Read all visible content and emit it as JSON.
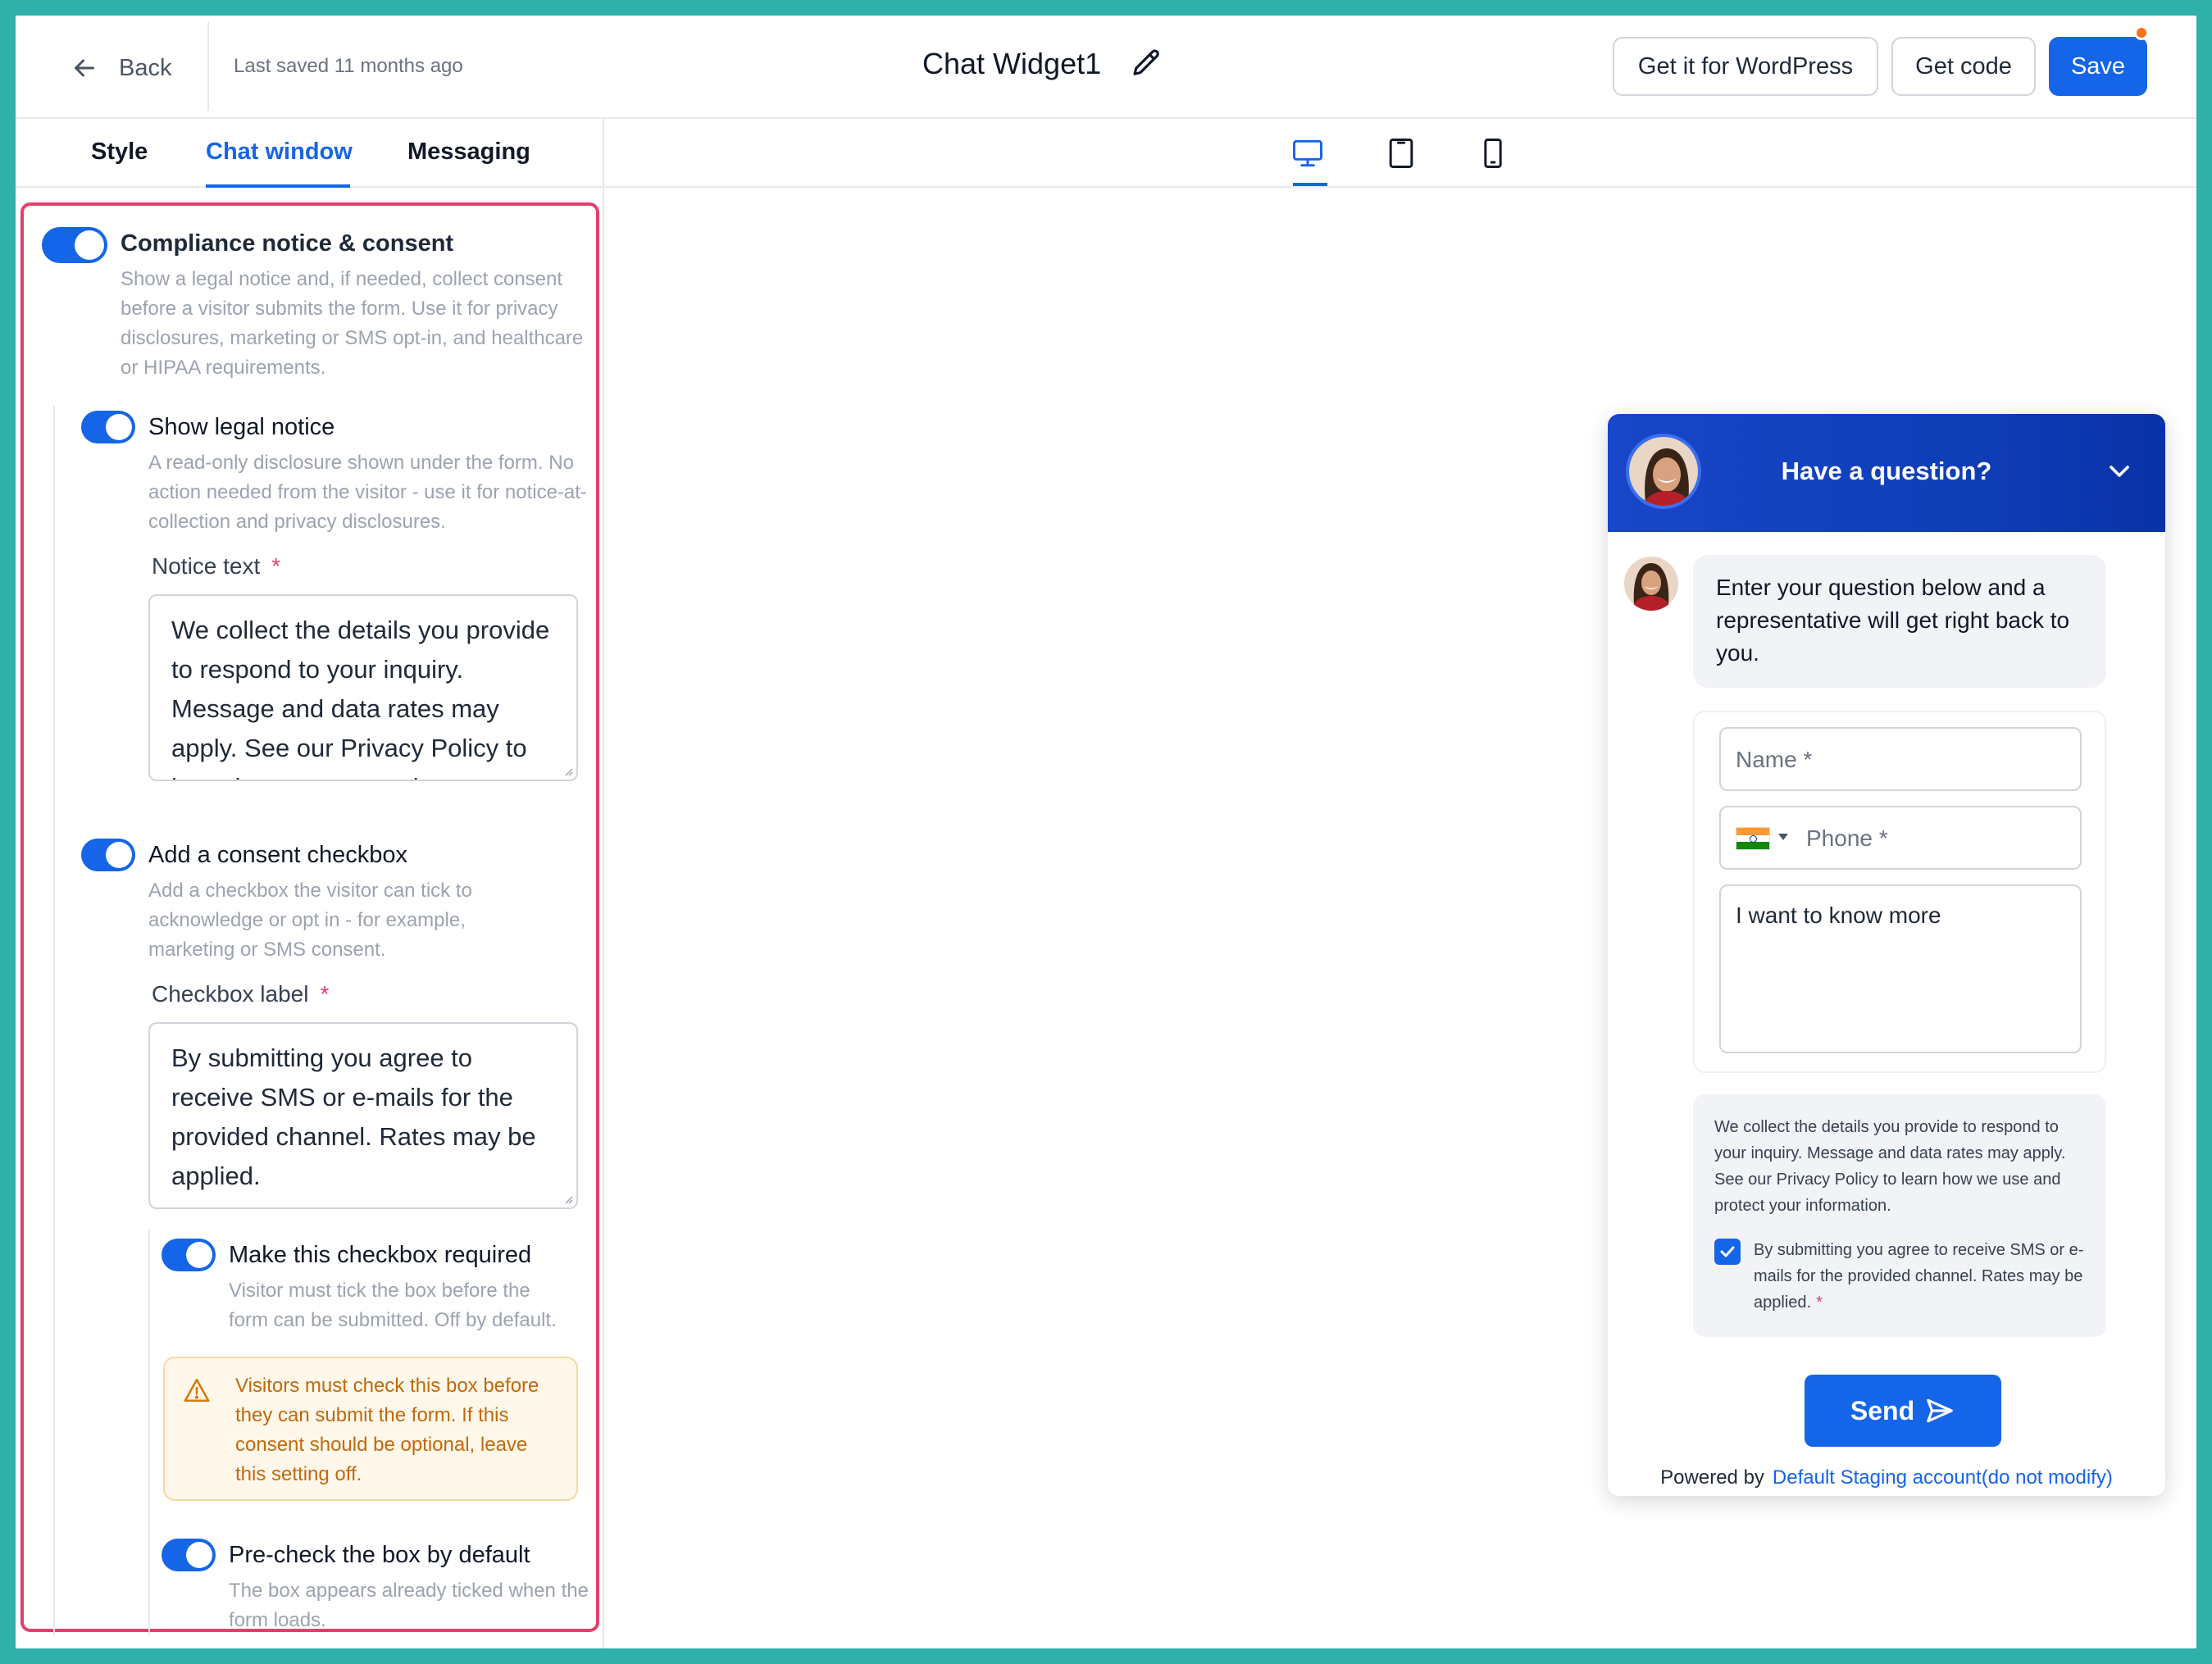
{
  "header": {
    "back_label": "Back",
    "last_saved": "Last saved 11 months ago",
    "title": "Chat Widget1",
    "wordpress_button": "Get it for WordPress",
    "code_button": "Get code",
    "save_button": "Save"
  },
  "tabs": [
    {
      "label": "Style",
      "active": false
    },
    {
      "label": "Chat window",
      "active": true
    },
    {
      "label": "Messaging",
      "active": false
    }
  ],
  "settings": {
    "compliance": {
      "label": "Compliance notice & consent",
      "enabled": true,
      "description": "Show a legal notice and, if needed, collect consent before a visitor submits the form. Use it for privacy disclosures, marketing or SMS opt-in, and healthcare or HIPAA requirements."
    },
    "legal_notice": {
      "label": "Show legal notice",
      "enabled": true,
      "description": "A read-only disclosure shown under the form. No action needed from the visitor - use it for notice-at-collection and privacy disclosures.",
      "field_label": "Notice text",
      "required_mark": "*",
      "value": "We collect the details you provide to respond to your inquiry. Message and data rates may apply. See our Privacy Policy to learn how we use and protect your information."
    },
    "consent_checkbox": {
      "label": "Add a consent checkbox",
      "enabled": true,
      "description": "Add a checkbox the visitor can tick to acknowledge or opt in - for example, marketing or SMS consent.",
      "field_label": "Checkbox label",
      "required_mark": "*",
      "value": "By submitting you agree to receive SMS or e-mails for the provided channel. Rates may be applied."
    },
    "required": {
      "label": "Make this checkbox required",
      "enabled": true,
      "description": "Visitor must tick the box before the form can be submitted. Off by default."
    },
    "warning": "Visitors must check this box before they can submit the form. If this consent should be optional, leave this setting off.",
    "precheck": {
      "label": "Pre-check the box by default",
      "enabled": true,
      "description": "The box appears already ticked when the form loads."
    }
  },
  "device_toggle": {
    "options": [
      "desktop-icon",
      "tablet-icon",
      "mobile-icon"
    ],
    "selected": "desktop"
  },
  "widget": {
    "header_title": "Have a question?",
    "greeting": "Enter your question below and a representative will get right back to you.",
    "name_placeholder": "Name *",
    "phone_placeholder": "Phone *",
    "message_value": "I want to know more",
    "notice": "We collect the details you provide to respond to your inquiry. Message and data rates may apply. See our Privacy Policy to learn how we use and protect your information.",
    "checkbox_label": "By submitting you agree to receive SMS or e-mails for the provided channel. Rates may be applied.",
    "checkbox_checked": true,
    "required_mark": "*",
    "send_button": "Send",
    "powered_by": "Powered by",
    "account_link": "Default Staging account(do not modify)"
  },
  "colors": {
    "accent": "#1565e8",
    "highlight_border": "#e0406a",
    "widget_header": "#1846c8",
    "warning_text": "#c2680c",
    "warning_bg": "#fff8ea",
    "save_dot": "#f97316"
  }
}
